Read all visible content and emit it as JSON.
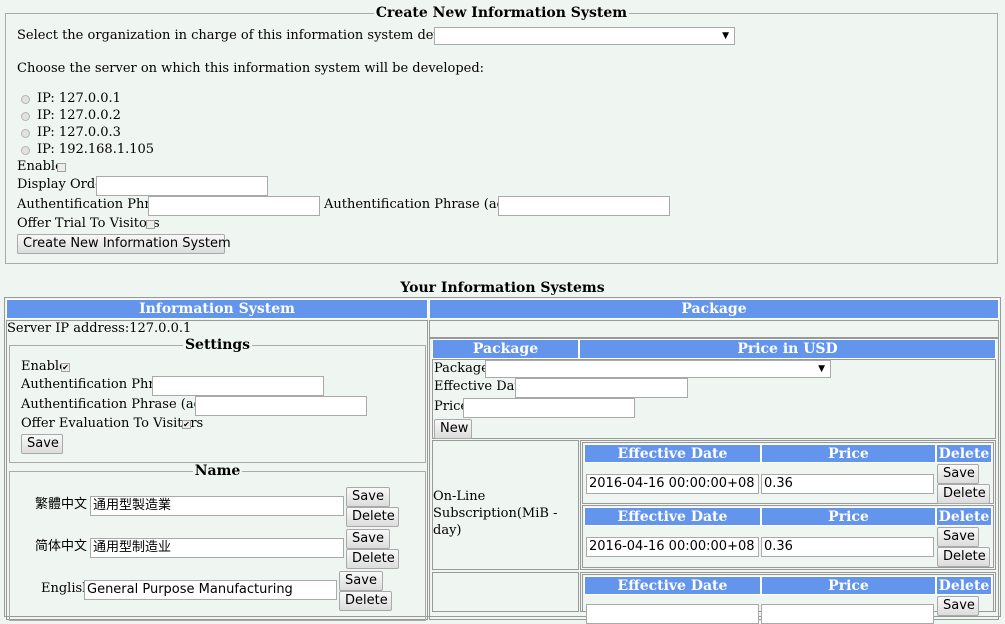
{
  "create_form": {
    "legend": "Create New Information System",
    "org_label": "Select the organization in charge of this information system development:",
    "org_value": "",
    "server_prompt": "Choose the server on which this information system will be developed:",
    "servers": [
      "IP: 127.0.0.1",
      "IP: 127.0.0.2",
      "IP: 127.0.0.3",
      "IP: 192.168.1.105"
    ],
    "enable_label": "Enable",
    "display_order_label": "Display Order",
    "display_order_value": "",
    "auth_label": "Authentification Phrase",
    "auth_value": "",
    "auth_again_label": "Authentification Phrase (again)",
    "auth_again_value": "",
    "trial_label": "Offer Trial To Visitors",
    "submit_label": "Create New Information System"
  },
  "systems": {
    "title": "Your Information Systems",
    "col_system": "Information System",
    "col_package": "Package",
    "server_ip": "Server IP address:127.0.0.1",
    "settings": {
      "legend": "Settings",
      "enable_label": "Enable",
      "enable_checked": "✔",
      "auth_label": "Authentification Phrase",
      "auth_value": "",
      "auth_again_label": "Authentification Phrase (again)",
      "auth_again_value": "",
      "eval_label": "Offer Evaluation To Visitors",
      "eval_checked": "✔",
      "save_label": "Save"
    },
    "name": {
      "legend": "Name",
      "rows": [
        {
          "lang": "繁體中文",
          "value": "通用型製造業",
          "save": "Save",
          "delete": "Delete"
        },
        {
          "lang": "简体中文",
          "value": "通用型制造业",
          "save": "Save",
          "delete": "Delete"
        },
        {
          "lang": "English",
          "value": "General Purpose Manufacturing",
          "save": "Save",
          "delete": "Delete"
        }
      ]
    },
    "package_panel": {
      "col_package": "Package",
      "col_price_usd": "Price in USD",
      "package_label": "Package",
      "package_value": "",
      "effective_date_label": "Effective Date",
      "effective_date_value": "",
      "price_label": "Price",
      "price_value": "",
      "new_label": "New",
      "subscription_label": "On-Line Subscription(MiB - day)",
      "price_table_headers": [
        "Effective Date",
        "Price",
        "Delete"
      ],
      "price_rows": [
        {
          "date": "2016-04-16 00:00:00+08",
          "price": "0.36",
          "save": "Save",
          "delete": "Delete"
        },
        {
          "date": "2016-04-16 00:00:00+08",
          "price": "0.36",
          "save": "Save",
          "delete": "Delete"
        }
      ],
      "third_row": {
        "save": "Save"
      }
    }
  }
}
